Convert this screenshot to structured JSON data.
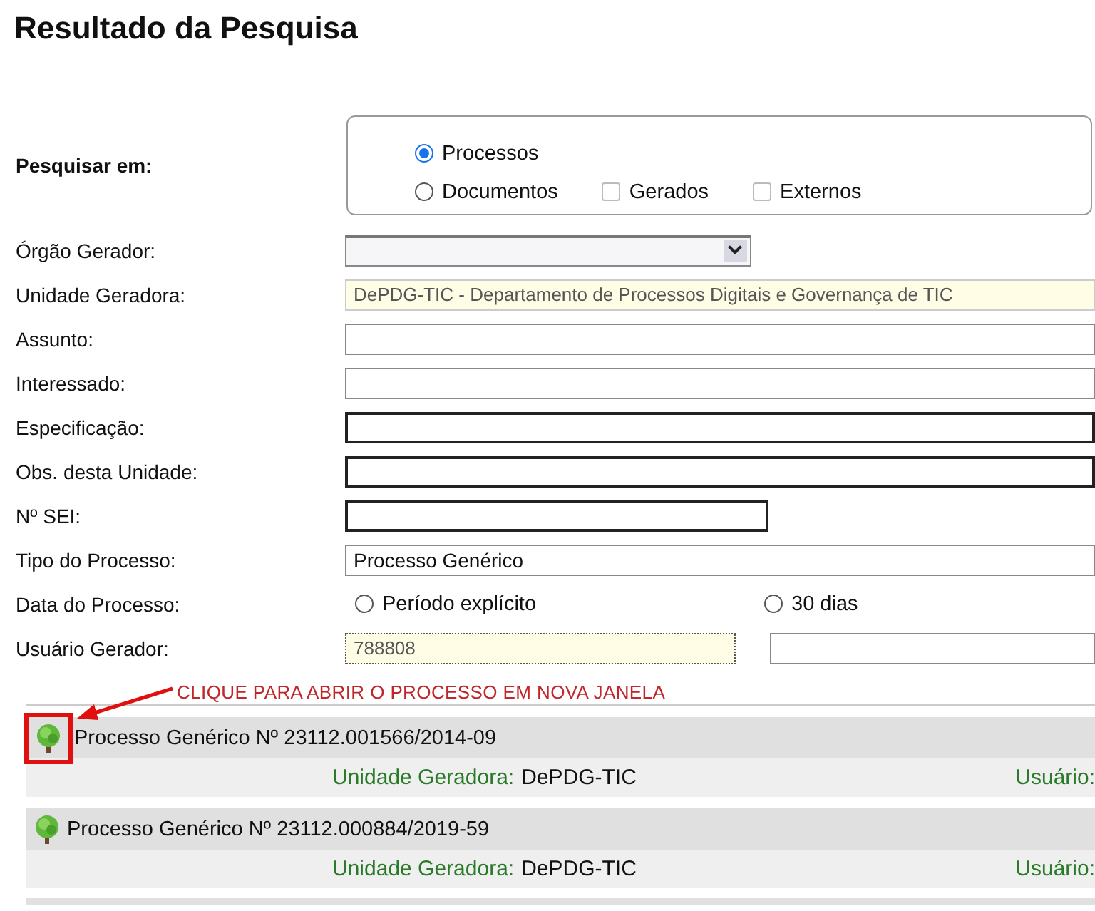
{
  "title": "Resultado da Pesquisa",
  "search_in": {
    "label": "Pesquisar em:",
    "options": [
      {
        "kind": "radio",
        "label": "Processos",
        "selected": true
      },
      {
        "kind": "radio",
        "label": "Documentos",
        "selected": false
      },
      {
        "kind": "checkbox",
        "label": "Gerados",
        "checked": false
      },
      {
        "kind": "checkbox",
        "label": "Externos",
        "checked": false
      }
    ]
  },
  "fields": [
    {
      "label": "Órgão Gerador:",
      "kind": "select"
    },
    {
      "label": "Unidade Geradora:",
      "kind": "readonly",
      "value": "DePDG-TIC - Departamento de Processos Digitais e Governança de TIC"
    },
    {
      "label": "Assunto:",
      "kind": "text"
    },
    {
      "label": "Interessado:",
      "kind": "text"
    },
    {
      "label": "Especificação:",
      "kind": "dark"
    },
    {
      "label": "Obs. desta Unidade:",
      "kind": "dark"
    },
    {
      "label": "Nº SEI:",
      "kind": "dark-short"
    },
    {
      "label": "Tipo do Processo:",
      "kind": "text",
      "value": "Processo Genérico"
    },
    {
      "label": "Data do Processo:",
      "kind": "radios",
      "options": [
        {
          "label": "Período explícito",
          "selected": false
        },
        {
          "label": "30 dias",
          "selected": false
        }
      ]
    },
    {
      "label": "Usuário Gerador:",
      "kind": "readonly-pair",
      "value": "788808"
    }
  ],
  "annotation": {
    "text": "CLIQUE PARA ABRIR O PROCESSO EM NOVA JANELA"
  },
  "results": [
    {
      "title": "Processo Genérico Nº 23112.001566/2014-09",
      "unit_label": "Unidade Geradora:",
      "unit": "DePDG-TIC",
      "user_label": "Usuário:",
      "highlighted": true
    },
    {
      "title": "Processo Genérico Nº 23112.000884/2019-59",
      "unit_label": "Unidade Geradora:",
      "unit": "DePDG-TIC",
      "user_label": "Usuário:",
      "highlighted": false
    }
  ]
}
